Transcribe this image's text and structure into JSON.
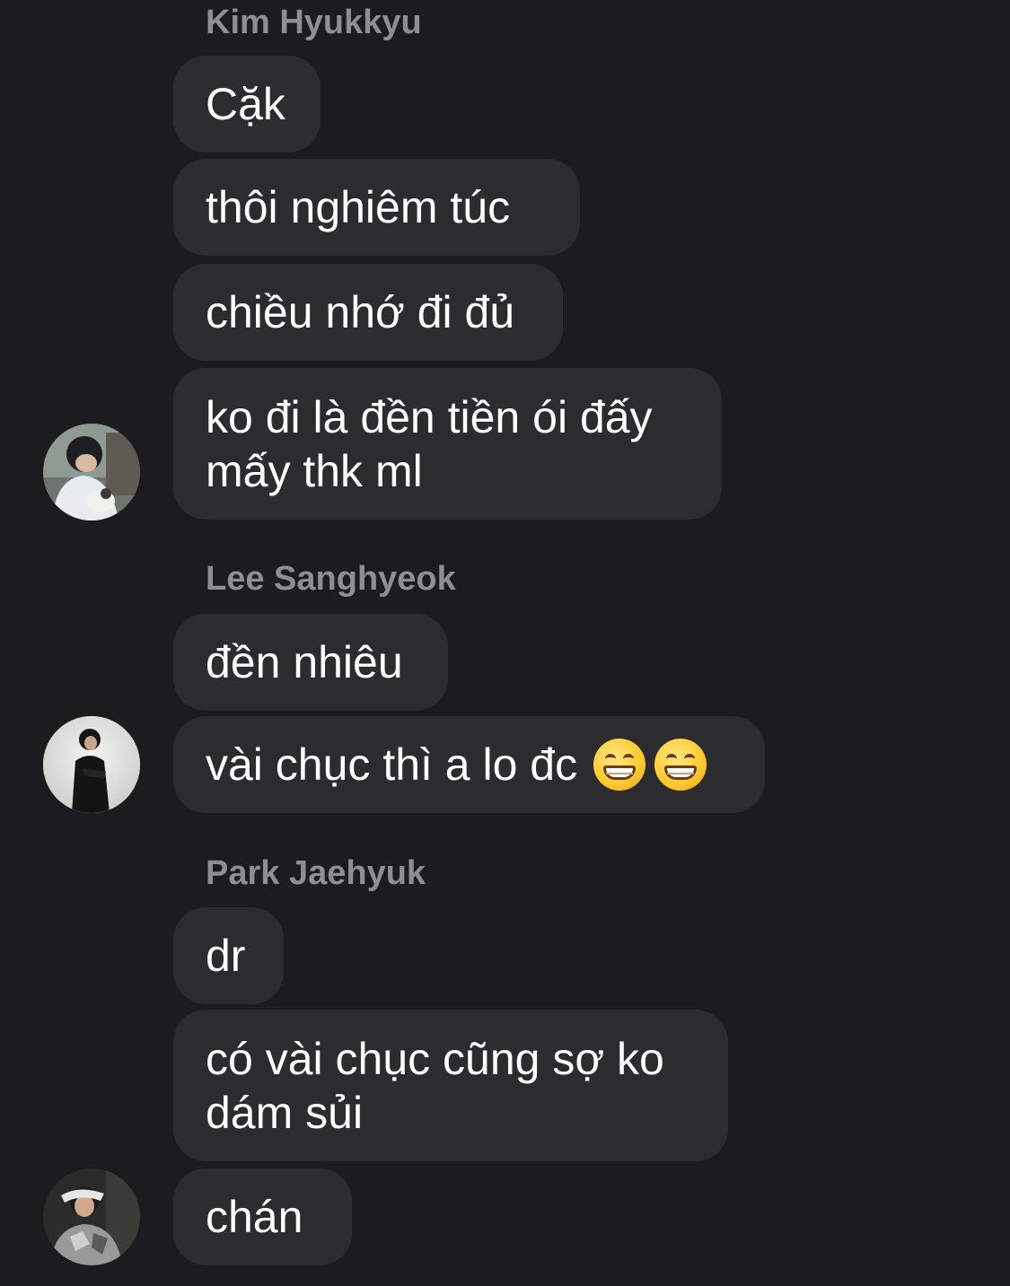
{
  "groups": [
    {
      "sender": "Kim Hyukkyu",
      "messages": [
        "Cặk",
        "thôi nghiêm túc",
        "chiều nhớ đi đủ",
        "ko đi là đền tiền ói đấy\nmấy thk ml"
      ]
    },
    {
      "sender": "Lee Sanghyeok",
      "messages": [
        "đền nhiêu",
        "vài chục thì a lo đc"
      ],
      "emoji": "grinning-face-with-smiling-eyes"
    },
    {
      "sender": "Park Jaehyuk",
      "messages": [
        "dr",
        "có vài chục cũng sợ ko\ndám sủi",
        "chán"
      ]
    }
  ],
  "colors": {
    "background": "#1c1c1e",
    "bubble": "#2c2c2e",
    "sender_name": "#8e8e93",
    "text": "#ffffff"
  }
}
